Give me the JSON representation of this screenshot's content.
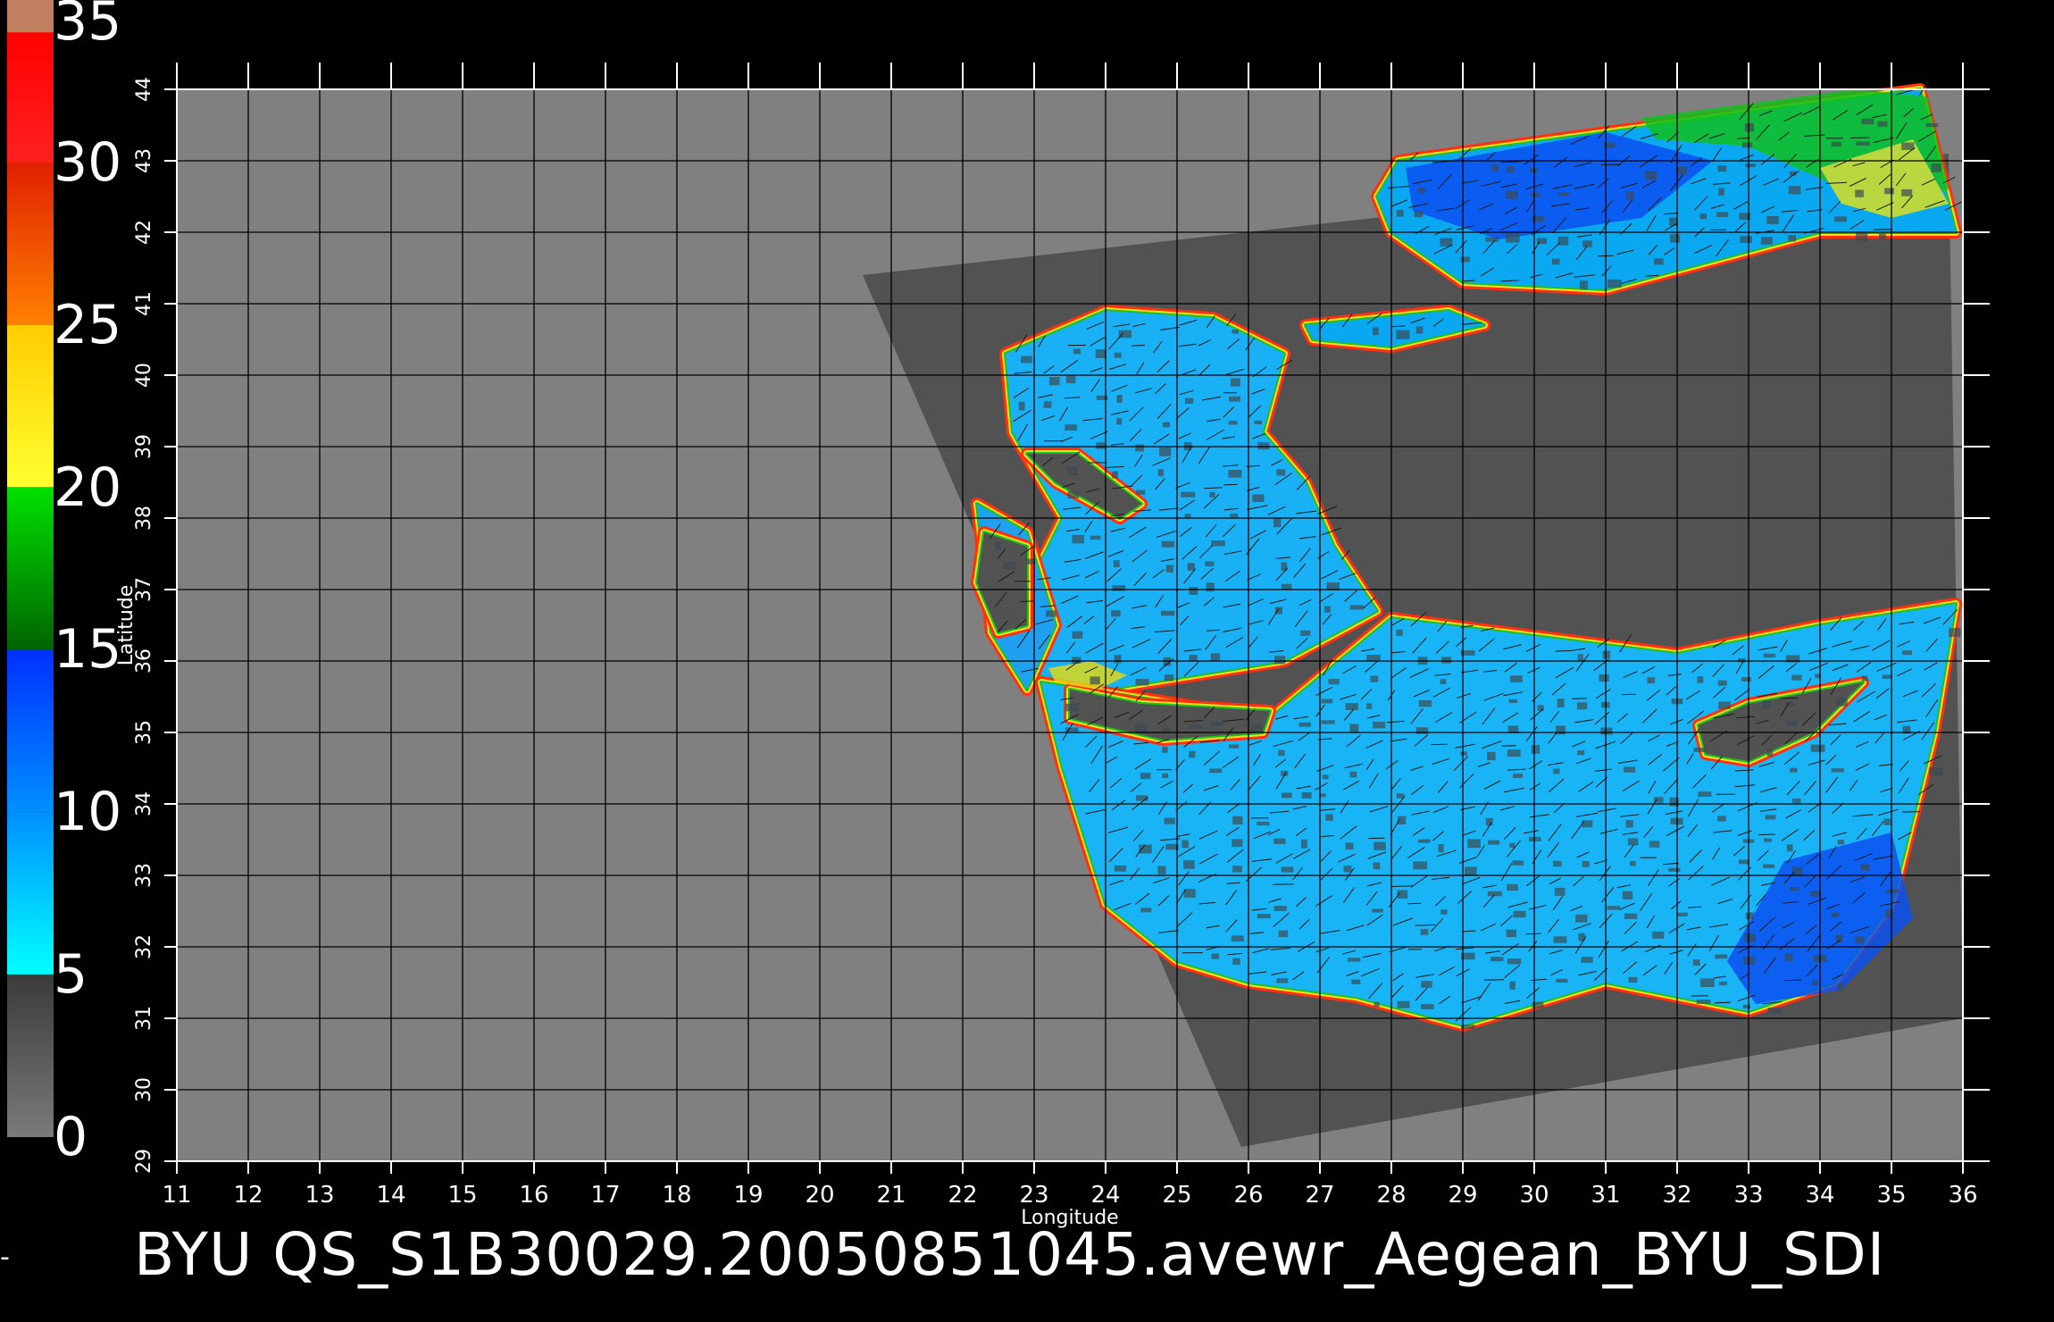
{
  "title": "BYU  QS_S1B30029.20050851045.avewr_Aegean_BYU_SDI",
  "left_edge_glyph": "-",
  "colorbar": {
    "labels": [
      "0",
      "5",
      "10",
      "15",
      "20",
      "25",
      "30",
      "35"
    ],
    "stops": [
      {
        "value": 0,
        "color": "#7a7a7a"
      },
      {
        "value": 5,
        "color": "#3a3a3a"
      },
      {
        "value": 5.01,
        "color": "#00ffff"
      },
      {
        "value": 10,
        "color": "#0090ff"
      },
      {
        "value": 15,
        "color": "#0030ff"
      },
      {
        "value": 15.01,
        "color": "#006400"
      },
      {
        "value": 20,
        "color": "#00e000"
      },
      {
        "value": 20.01,
        "color": "#ffff30"
      },
      {
        "value": 25,
        "color": "#ffcc00"
      },
      {
        "value": 25.01,
        "color": "#ff8000"
      },
      {
        "value": 30,
        "color": "#e02000"
      },
      {
        "value": 30.01,
        "color": "#ff2020"
      },
      {
        "value": 34,
        "color": "#ff0000"
      },
      {
        "value": 34.01,
        "color": "#c08060"
      },
      {
        "value": 35,
        "color": "#c08060"
      }
    ]
  },
  "map": {
    "xlabel": "Longitude",
    "ylabel": "Latitude",
    "lon_range": [
      11,
      36
    ],
    "lat_range": [
      29,
      44
    ],
    "lon_ticks": [
      "11",
      "12",
      "13",
      "14",
      "15",
      "16",
      "17",
      "18",
      "19",
      "20",
      "21",
      "22",
      "23",
      "24",
      "25",
      "26",
      "27",
      "28",
      "29",
      "30",
      "31",
      "32",
      "33",
      "34",
      "35",
      "36"
    ],
    "lat_ticks": [
      "29",
      "30",
      "31",
      "32",
      "33",
      "34",
      "35",
      "36",
      "37",
      "38",
      "39",
      "40",
      "41",
      "42",
      "43",
      "44"
    ],
    "background_color": "#808080",
    "swath_color": "#525252",
    "grid_color": "#000000",
    "swath_corners_lonlat": [
      [
        20.6,
        41.4
      ],
      [
        35.8,
        43.1
      ],
      [
        36.0,
        31.0
      ],
      [
        25.9,
        29.2
      ]
    ],
    "sea_regions": [
      {
        "name": "black-sea",
        "color": "#0aa8f0",
        "points": [
          [
            28.1,
            43.0
          ],
          [
            35.4,
            44.0
          ],
          [
            35.9,
            42.0
          ],
          [
            34.0,
            42.0
          ],
          [
            31.0,
            41.2
          ],
          [
            29.0,
            41.3
          ],
          [
            28.0,
            42.0
          ],
          [
            27.8,
            42.5
          ]
        ]
      },
      {
        "name": "sea-of-marmara",
        "color": "#0aa8f0",
        "points": [
          [
            26.8,
            40.7
          ],
          [
            28.8,
            40.9
          ],
          [
            29.3,
            40.7
          ],
          [
            28.0,
            40.4
          ],
          [
            26.9,
            40.5
          ]
        ]
      },
      {
        "name": "aegean-sea",
        "color": "#1ab0f5",
        "points": [
          [
            22.6,
            40.3
          ],
          [
            24.0,
            40.9
          ],
          [
            25.5,
            40.8
          ],
          [
            26.5,
            40.3
          ],
          [
            26.2,
            39.2
          ],
          [
            26.8,
            38.5
          ],
          [
            27.2,
            37.6
          ],
          [
            27.8,
            36.7
          ],
          [
            26.5,
            36.0
          ],
          [
            24.0,
            35.6
          ],
          [
            23.1,
            35.8
          ],
          [
            22.9,
            37.0
          ],
          [
            23.4,
            38.0
          ],
          [
            22.7,
            39.2
          ]
        ]
      },
      {
        "name": "eastern-mediterranean",
        "color": "#18b4f5",
        "points": [
          [
            23.1,
            35.7
          ],
          [
            26.3,
            35.2
          ],
          [
            28.0,
            36.6
          ],
          [
            30.4,
            36.3
          ],
          [
            32.0,
            36.1
          ],
          [
            34.0,
            36.5
          ],
          [
            35.9,
            36.8
          ],
          [
            35.6,
            35.0
          ],
          [
            35.0,
            32.6
          ],
          [
            34.2,
            31.5
          ],
          [
            33.0,
            31.1
          ],
          [
            31.0,
            31.5
          ],
          [
            29.0,
            30.9
          ],
          [
            27.5,
            31.3
          ],
          [
            26.0,
            31.5
          ],
          [
            25.0,
            31.8
          ],
          [
            24.0,
            32.6
          ],
          [
            23.4,
            34.5
          ]
        ]
      },
      {
        "name": "ionian-east-edge",
        "color": "#20a0f0",
        "points": [
          [
            22.2,
            38.2
          ],
          [
            22.9,
            37.8
          ],
          [
            23.3,
            36.5
          ],
          [
            22.9,
            35.6
          ],
          [
            22.4,
            36.4
          ]
        ]
      }
    ],
    "land_regions": [
      {
        "name": "crete",
        "color": "#525252",
        "points": [
          [
            23.5,
            35.6
          ],
          [
            24.5,
            35.4
          ],
          [
            26.3,
            35.3
          ],
          [
            26.2,
            35.0
          ],
          [
            24.8,
            34.9
          ],
          [
            23.5,
            35.2
          ]
        ]
      },
      {
        "name": "cyprus",
        "color": "#525252",
        "points": [
          [
            32.3,
            35.1
          ],
          [
            33.0,
            35.4
          ],
          [
            34.6,
            35.7
          ],
          [
            33.9,
            35.0
          ],
          [
            33.0,
            34.6
          ],
          [
            32.4,
            34.7
          ]
        ]
      },
      {
        "name": "euboea",
        "color": "#525252",
        "points": [
          [
            22.9,
            38.9
          ],
          [
            23.6,
            38.9
          ],
          [
            24.5,
            38.2
          ],
          [
            24.2,
            38.0
          ],
          [
            23.3,
            38.5
          ]
        ]
      },
      {
        "name": "peloponnese-tip",
        "color": "#525252",
        "points": [
          [
            22.3,
            37.8
          ],
          [
            22.9,
            37.6
          ],
          [
            22.9,
            36.5
          ],
          [
            22.5,
            36.4
          ],
          [
            22.2,
            37.1
          ]
        ]
      }
    ],
    "high_wind_patches": [
      {
        "name": "black-sea-north-green",
        "color": "#10c020",
        "points": [
          [
            31.5,
            43.6
          ],
          [
            34.5,
            44.0
          ],
          [
            35.5,
            43.9
          ],
          [
            35.8,
            42.6
          ],
          [
            34.8,
            42.4
          ],
          [
            33.0,
            43.2
          ],
          [
            31.7,
            43.3
          ]
        ]
      },
      {
        "name": "black-sea-east-yellow",
        "color": "#d8e020",
        "points": [
          [
            34.0,
            42.9
          ],
          [
            35.3,
            43.3
          ],
          [
            35.8,
            42.4
          ],
          [
            35.0,
            42.2
          ],
          [
            34.3,
            42.4
          ]
        ]
      },
      {
        "name": "aegean-sw-yellow",
        "color": "#e0d818",
        "points": [
          [
            23.2,
            35.9
          ],
          [
            23.8,
            36.0
          ],
          [
            24.3,
            35.8
          ],
          [
            23.9,
            35.6
          ],
          [
            23.3,
            35.7
          ]
        ]
      },
      {
        "name": "deep-blue-levant",
        "color": "#0a50f0",
        "points": [
          [
            33.5,
            33.2
          ],
          [
            35.0,
            33.6
          ],
          [
            35.3,
            32.4
          ],
          [
            34.3,
            31.4
          ],
          [
            33.1,
            31.2
          ],
          [
            32.7,
            31.8
          ]
        ]
      },
      {
        "name": "deep-blue-black-sea",
        "color": "#0a50f0",
        "points": [
          [
            28.2,
            42.9
          ],
          [
            31.0,
            43.4
          ],
          [
            32.5,
            43.0
          ],
          [
            31.5,
            42.2
          ],
          [
            29.5,
            41.9
          ],
          [
            28.3,
            42.3
          ]
        ]
      }
    ]
  }
}
